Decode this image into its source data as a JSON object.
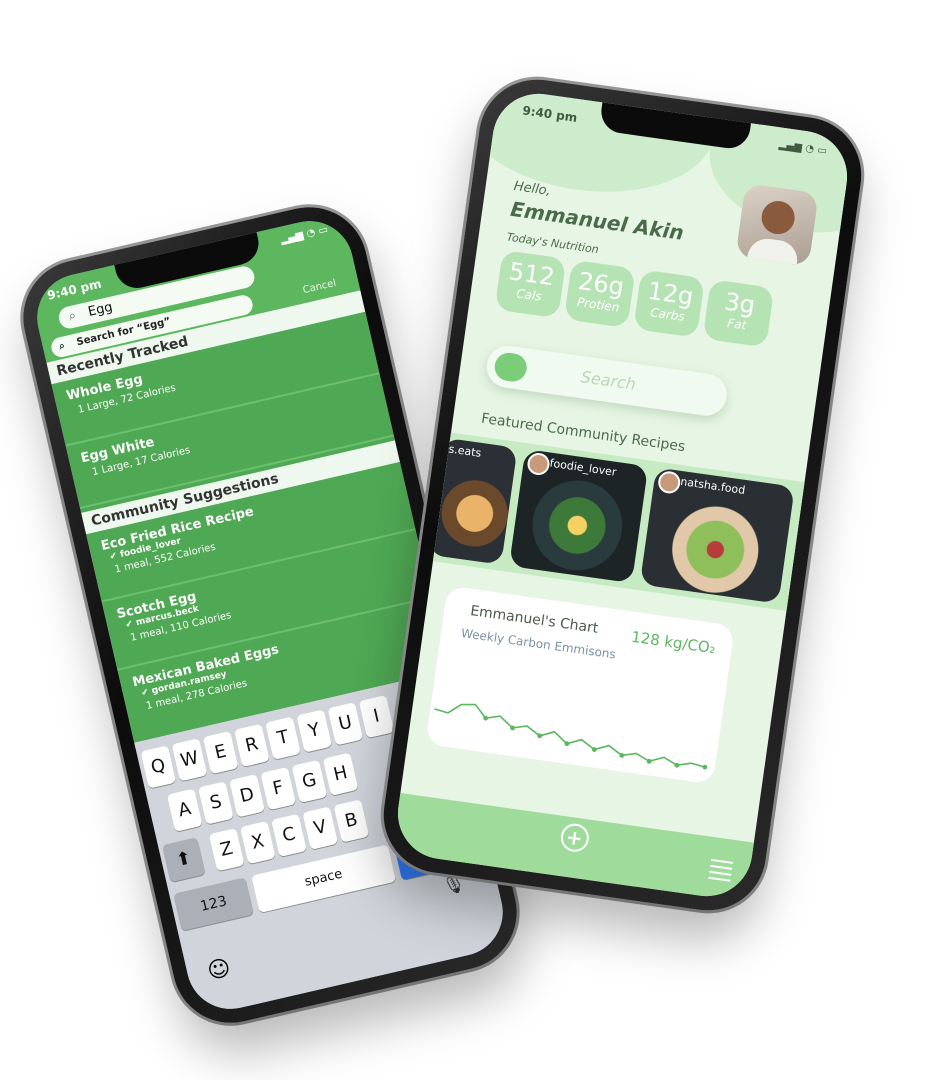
{
  "left_phone": {
    "time": "9:40 pm",
    "search_value": "Egg",
    "search_for": "Search for “Egg”",
    "cancel_label": "Cancel",
    "recently_tracked_header": "Recently Tracked",
    "recently_tracked": [
      {
        "title": "Whole Egg",
        "subtitle": "1 Large, 72 Calories"
      },
      {
        "title": "Egg White",
        "subtitle": "1 Large, 17 Calories"
      }
    ],
    "community_header": "Community Suggestions",
    "community": [
      {
        "title": "Eco Fried Rice Recipe",
        "user": "foodie_lover",
        "subtitle": "1 meal, 552 Calories"
      },
      {
        "title": "Scotch Egg",
        "user": "marcus.beck",
        "subtitle": "1 meal, 110 Calories"
      },
      {
        "title": "Mexican Baked Eggs",
        "user": "gordan.ramsey",
        "subtitle": "1 meal, 278 Calories"
      }
    ],
    "keyboard": {
      "row1": [
        "Q",
        "W",
        "E",
        "R",
        "T",
        "Y",
        "U",
        "I"
      ],
      "row2": [
        "A",
        "S",
        "D",
        "F",
        "G",
        "H"
      ],
      "row3": [
        "Z",
        "X",
        "C",
        "V",
        "B"
      ],
      "num_key": "123",
      "space_key": "space"
    }
  },
  "right_phone": {
    "time": "9:40 pm",
    "greeting": "Hello,",
    "user_name": "Emmanuel Akin",
    "nutrition_label": "Today's Nutrition",
    "nutrition": [
      {
        "value": "512",
        "label": "Cals"
      },
      {
        "value": "26g",
        "label": "Protien"
      },
      {
        "value": "12g",
        "label": "Carbs"
      },
      {
        "value": "3g",
        "label": "Fat"
      }
    ],
    "search_placeholder": "Search",
    "featured_label": "Featured Community Recipes",
    "recipes": [
      {
        "user": "s.eats"
      },
      {
        "user": "foodie_lover"
      },
      {
        "user": "natsha.food"
      }
    ],
    "chart_title": "Emmanuel's Chart",
    "chart_subtitle": "Weekly Carbon Emmisons",
    "chart_value": "128 kg/CO₂"
  },
  "colors": {
    "green_dark": "#4fa853",
    "green_light": "#e7f5e4",
    "accent": "#5bb85d"
  }
}
